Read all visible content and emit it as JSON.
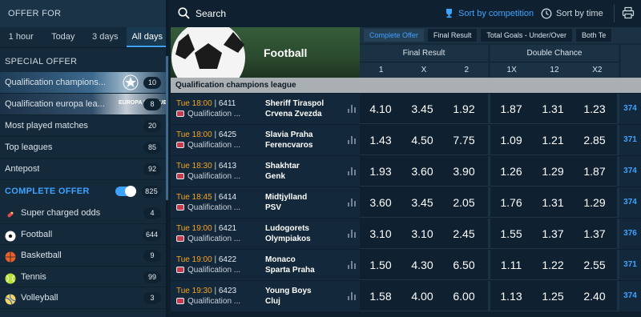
{
  "sidebar": {
    "offer_for": "OFFER FOR",
    "period_tabs": [
      {
        "label": "1 hour"
      },
      {
        "label": "Today"
      },
      {
        "label": "3 days"
      },
      {
        "label": "All days"
      }
    ],
    "active_period": "All days",
    "special_offer_title": "SPECIAL OFFER",
    "special_items": [
      {
        "label": "Qualification champions...",
        "count": "10"
      },
      {
        "label": "Qualification europa lea...",
        "count": "8"
      },
      {
        "label": "Most played matches",
        "count": "20"
      },
      {
        "label": "Top leagues",
        "count": "85"
      },
      {
        "label": "Antepost",
        "count": "92"
      }
    ],
    "europa_emblem": "EUROPA LEAGUE",
    "complete_offer_title": "COMPLETE OFFER",
    "complete_offer_count": "825",
    "sports": [
      {
        "label": "Super charged odds",
        "count": "4",
        "icon": "rocket-icon"
      },
      {
        "label": "Football",
        "count": "644",
        "icon": "football-icon"
      },
      {
        "label": "Basketball",
        "count": "9",
        "icon": "basketball-icon"
      },
      {
        "label": "Tennis",
        "count": "99",
        "icon": "tennis-ball-icon"
      },
      {
        "label": "Volleyball",
        "count": "3",
        "icon": "volleyball-icon"
      }
    ]
  },
  "topbar": {
    "search_label": "Search",
    "sort_competition": "Sort by competition",
    "sort_time": "Sort by time"
  },
  "banner": {
    "sport": "Football"
  },
  "market_tabs": [
    {
      "label": "Complete Offer"
    },
    {
      "label": "Final Result"
    },
    {
      "label": "Total Goals - Under/Over"
    },
    {
      "label": "Both Te"
    }
  ],
  "groups": [
    {
      "title": "Final Result",
      "cols": [
        "1",
        "X",
        "2"
      ]
    },
    {
      "title": "Double Chance",
      "cols": [
        "1X",
        "12",
        "X2"
      ]
    }
  ],
  "competition": "Qualification champions league",
  "events": [
    {
      "day": "Tue",
      "time": "18:00",
      "code": "6411",
      "comp": "Qualification ...",
      "home": "Sheriff Tiraspol",
      "away": "Crvena Zvezda",
      "odds": [
        "4.10",
        "3.45",
        "1.92",
        "1.87",
        "1.31",
        "1.23"
      ],
      "more": "374"
    },
    {
      "day": "Tue",
      "time": "18:00",
      "code": "6425",
      "comp": "Qualification ...",
      "home": "Slavia Praha",
      "away": "Ferencvaros",
      "odds": [
        "1.43",
        "4.50",
        "7.75",
        "1.09",
        "1.21",
        "2.85"
      ],
      "more": "371"
    },
    {
      "day": "Tue",
      "time": "18:30",
      "code": "6413",
      "comp": "Qualification ...",
      "home": "Shakhtar",
      "away": "Genk",
      "odds": [
        "1.93",
        "3.60",
        "3.90",
        "1.26",
        "1.29",
        "1.87"
      ],
      "more": "374"
    },
    {
      "day": "Tue",
      "time": "18:45",
      "code": "6414",
      "comp": "Qualification ...",
      "home": "Midtjylland",
      "away": "PSV",
      "odds": [
        "3.60",
        "3.45",
        "2.05",
        "1.76",
        "1.31",
        "1.29"
      ],
      "more": "374"
    },
    {
      "day": "Tue",
      "time": "19:00",
      "code": "6421",
      "comp": "Qualification ...",
      "home": "Ludogorets",
      "away": "Olympiakos",
      "odds": [
        "3.10",
        "3.10",
        "2.45",
        "1.55",
        "1.37",
        "1.37"
      ],
      "more": "376"
    },
    {
      "day": "Tue",
      "time": "19:00",
      "code": "6422",
      "comp": "Qualification ...",
      "home": "Monaco",
      "away": "Sparta Praha",
      "odds": [
        "1.50",
        "4.30",
        "6.50",
        "1.11",
        "1.22",
        "2.55"
      ],
      "more": "371"
    },
    {
      "day": "Tue",
      "time": "19:30",
      "code": "6423",
      "comp": "Qualification ...",
      "home": "Young Boys",
      "away": "Cluj",
      "odds": [
        "1.58",
        "4.00",
        "6.00",
        "1.13",
        "1.25",
        "2.40"
      ],
      "more": "374"
    }
  ],
  "colors": {
    "accent": "#3ea3ff",
    "time": "#f5a524",
    "competition_strip": "#a9afb3"
  }
}
